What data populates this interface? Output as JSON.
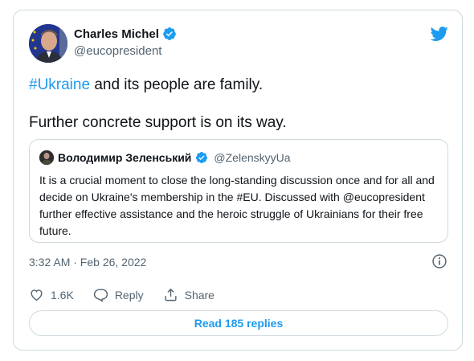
{
  "author": {
    "name": "Charles Michel",
    "handle": "@eucopresident"
  },
  "tweet": {
    "hashtag": "#Ukraine",
    "line1_rest": " and its people are family.",
    "line2": "Further concrete support is on its way."
  },
  "quote": {
    "name": "Володимир Зеленський",
    "handle": "@ZelenskyyUa",
    "body": "It is a crucial moment to close the long-standing discussion once and for all and decide on Ukraine's membership in the #EU. Discussed with @eucopresident further effective assistance and the heroic struggle of Ukrainians for their free future."
  },
  "meta": {
    "timestamp": "3:32 AM · Feb 26, 2022"
  },
  "actions": {
    "likes": "1.6K",
    "reply_label": "Reply",
    "share_label": "Share"
  },
  "read_replies_label": "Read 185 replies",
  "colors": {
    "accent": "#1d9bf0",
    "text_primary": "#0f1419",
    "text_secondary": "#536471",
    "border": "#cfd9de"
  },
  "icons": [
    "verified-badge-icon",
    "twitter-bird-icon",
    "info-icon",
    "heart-icon",
    "reply-bubble-icon",
    "share-icon"
  ]
}
